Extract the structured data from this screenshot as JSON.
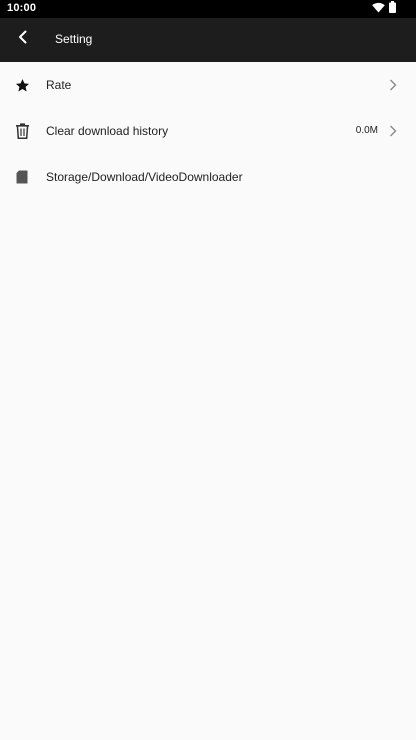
{
  "status_bar": {
    "time": "10:00",
    "icons": [
      "wifi-icon",
      "battery-icon"
    ]
  },
  "toolbar": {
    "title": "Setting",
    "back_icon": "back-arrow-icon"
  },
  "settings": {
    "items": [
      {
        "label": "Rate",
        "icon": "star-icon",
        "value": "",
        "has_chevron": true
      },
      {
        "label": "Clear download history",
        "icon": "trash-icon",
        "value": "0.0M",
        "has_chevron": true
      },
      {
        "label": "Storage/Download/VideoDownloader",
        "icon": "sd-card-icon",
        "value": "",
        "has_chevron": false
      }
    ]
  },
  "colors": {
    "status_bar_bg": "#000000",
    "toolbar_bg": "#1d1d1d",
    "page_bg": "#fafafa",
    "text": "#222222",
    "icon": "#333333",
    "chevron": "#8a8a8a"
  }
}
